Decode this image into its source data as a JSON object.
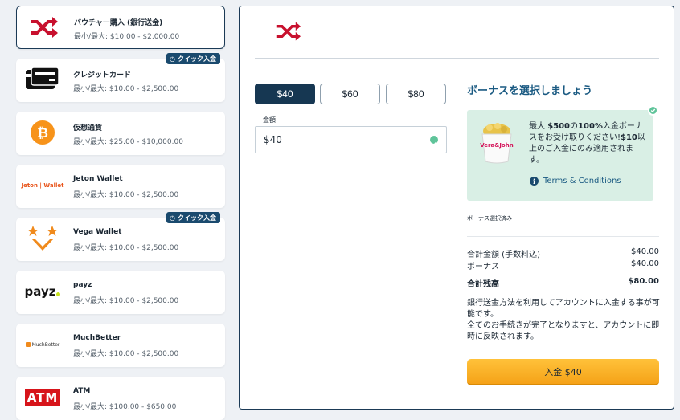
{
  "payment_methods": [
    {
      "name": "バウチャー購入 (銀行送金)",
      "limits": "最小/最大: $10.00 - $2,000.00",
      "logo": "shuffle-icon",
      "quick": false
    },
    {
      "name": "クレジットカード",
      "limits": "最小/最大: $10.00 - $2,500.00",
      "logo": "credit-card-icon",
      "quick": true
    },
    {
      "name": "仮想通貨",
      "limits": "最小/最大: $25.00 - $10,000.00",
      "logo": "bitcoin-icon",
      "quick": false
    },
    {
      "name": "Jeton Wallet",
      "limits": "最小/最大: $10.00 - $2,500.00",
      "logo": "jeton-logo",
      "logo_text": "Jeton | Wallet",
      "quick": false
    },
    {
      "name": "Vega Wallet",
      "limits": "最小/最大: $10.00 - $2,500.00",
      "logo": "vega-logo",
      "quick": true
    },
    {
      "name": "payz",
      "limits": "最小/最大: $10.00 - $2,500.00",
      "logo": "payz-logo",
      "logo_text": "payz",
      "quick": false
    },
    {
      "name": "MuchBetter",
      "limits": "最小/最大: $10.00 - $2,500.00",
      "logo": "muchbetter-logo",
      "logo_text": "MuchBetter",
      "quick": false
    },
    {
      "name": "ATM",
      "limits": "最小/最大: $100.00 - $650.00",
      "logo": "atm-logo",
      "logo_text": "ATM",
      "quick": false
    }
  ],
  "quick_badge_label": "クイック入金",
  "amount_options": [
    "$40",
    "$60",
    "$80"
  ],
  "selected_amount_index": 0,
  "amount_field": {
    "label": "金額",
    "value": "$40"
  },
  "bonus": {
    "title": "ボーナスを選択しましょう",
    "text_1": "最大 ",
    "text_2": "$500",
    "text_3": "の",
    "text_4": "100%",
    "text_5": "入金ボーナスをお受け取りください!",
    "text_6": "$10",
    "text_7": "以上のご入金にのみ適用されます。",
    "image_text": "Vera&John",
    "terms_label": "Terms & Conditions",
    "selected_label": "ボーナス選択済み"
  },
  "summary": {
    "total_label": "合計金額 (手数料込)",
    "total_value": "$40.00",
    "bonus_label": "ボーナス",
    "bonus_value": "$40.00",
    "balance_label": "合計残高",
    "balance_value": "$80.00"
  },
  "note": "銀行送金方法を利用してアカウントに入金する事が可能です。\n全てのお手続きが完了となりますと、アカウントに即時に反映されます。",
  "deposit_button_label": "入金 $40",
  "colors": {
    "accent": "#163752",
    "brand_red": "#c8102e",
    "success": "#5fc49a",
    "button": "#f5a218"
  }
}
